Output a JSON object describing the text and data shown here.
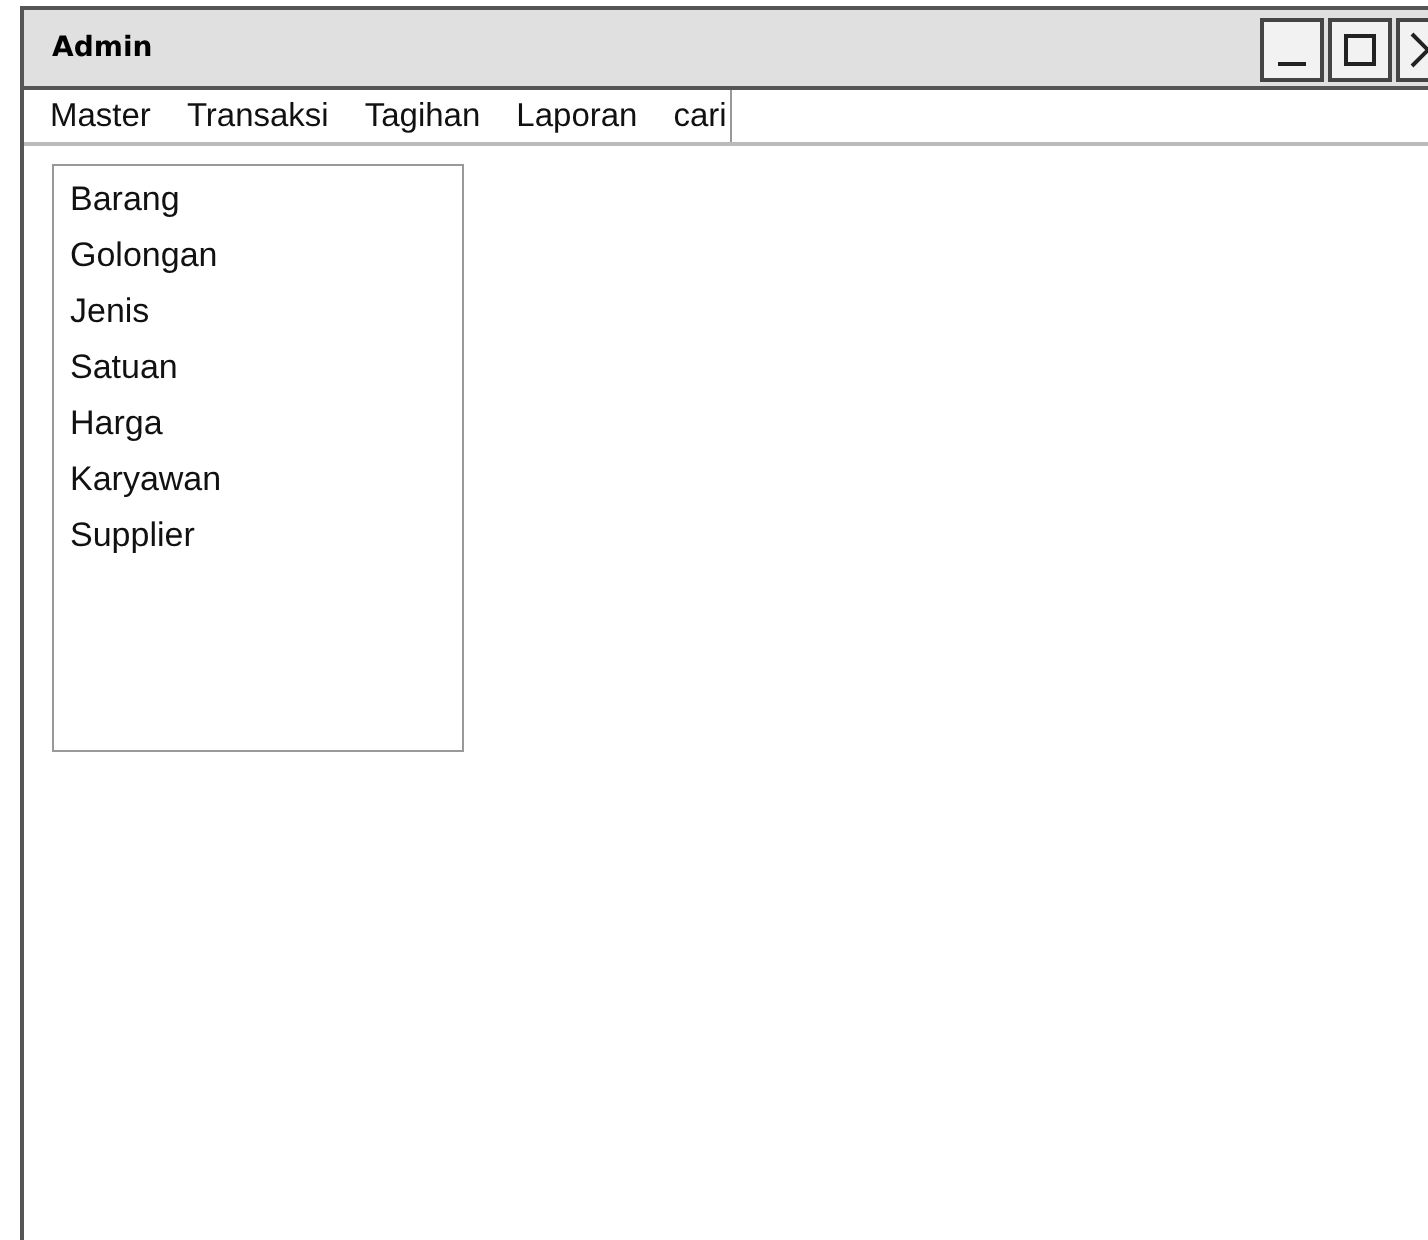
{
  "window": {
    "title": "Admin"
  },
  "menu": [
    {
      "label": "Master"
    },
    {
      "label": "Transaksi"
    },
    {
      "label": "Tagihan"
    },
    {
      "label": "Laporan"
    },
    {
      "label": "cari"
    }
  ],
  "list": {
    "items": [
      {
        "label": "Barang"
      },
      {
        "label": "Golongan"
      },
      {
        "label": "Jenis"
      },
      {
        "label": "Satuan"
      },
      {
        "label": "Harga"
      },
      {
        "label": "Karyawan"
      },
      {
        "label": "Supplier"
      }
    ]
  }
}
